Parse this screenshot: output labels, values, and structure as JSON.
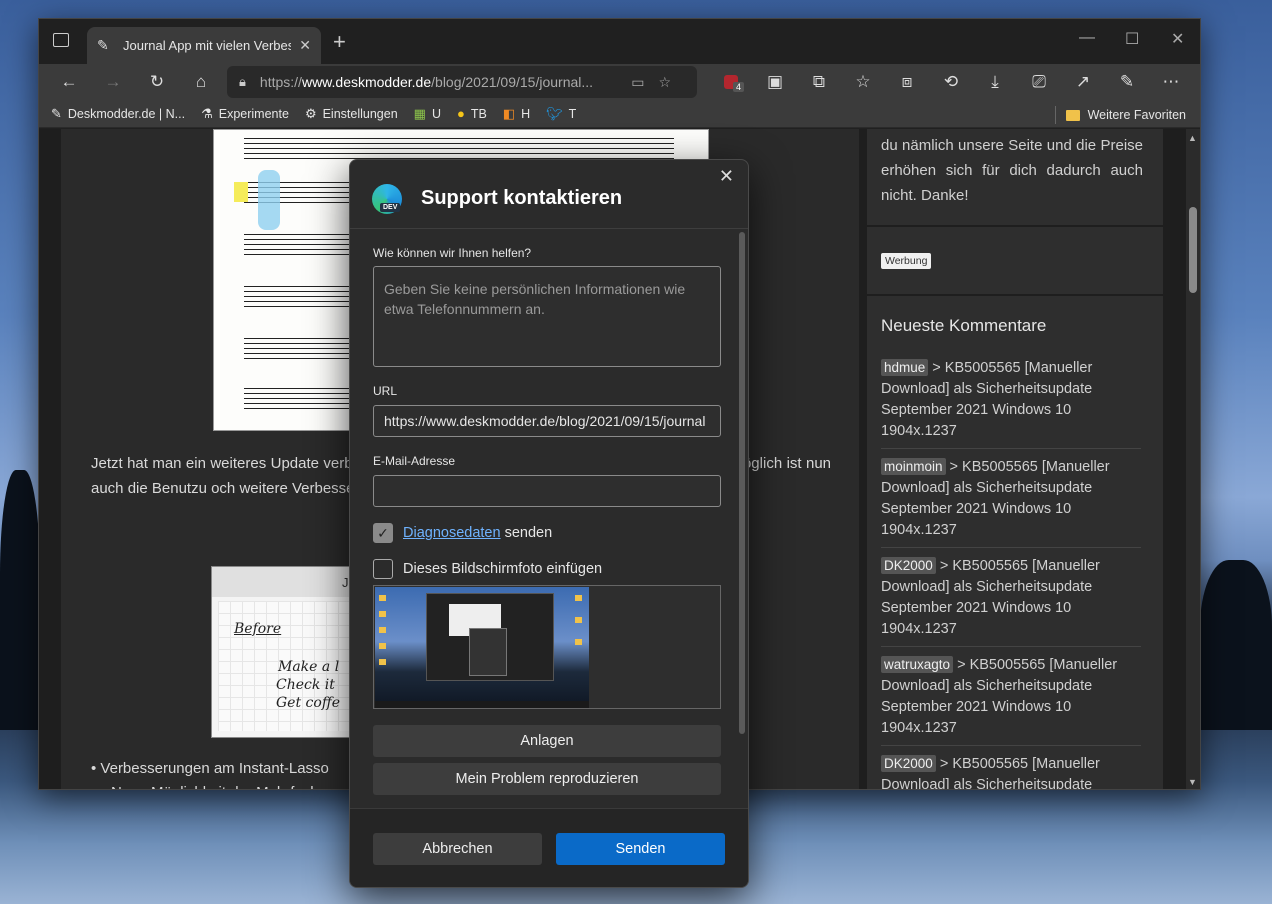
{
  "browser": {
    "tab_title": "Journal App mit vielen Verbesser",
    "url_prefix": "https://",
    "url_host": "www.deskmodder.de",
    "url_path": "/blog/2021/09/15/journal...",
    "extension_badge": "4"
  },
  "favorites": {
    "items": [
      {
        "label": "Deskmodder.de | N...",
        "icon": "pen-icon"
      },
      {
        "label": "Experimente",
        "icon": "flask-icon"
      },
      {
        "label": "Einstellungen",
        "icon": "gear-icon"
      },
      {
        "label": "U",
        "icon": "ext-icon"
      },
      {
        "label": "TB",
        "icon": "coin-icon"
      },
      {
        "label": "H",
        "icon": "stack-icon"
      },
      {
        "label": "T",
        "icon": "bird-icon"
      }
    ],
    "more_label": "Weitere Favoriten"
  },
  "article": {
    "paragraph": "Jetzt hat man ein weiteres Update                                                                                verbessert. Unterstützt werden für das Schreibe                                                                          ch Deutsch. Möglich ist nun auch die Benutzu                                                                            och weitere Verbesserungen vorgenommen.",
    "bullet_1": "Verbesserungen am Instant-Lasso",
    "bullet_2": "Neue Möglichkeit der Mehrfach",
    "handwriting": [
      "Before",
      "Make a l",
      "Check it",
      "Get coffe"
    ],
    "screenshot_title": "J"
  },
  "sidebar": {
    "intro": "du nämlich unsere Seite und die Preise erhöhen sich für dich dadurch auch nicht. Danke!",
    "ad_label": "Werbung",
    "heading": "Neueste Kommentare",
    "comments": [
      {
        "author": "hdmue",
        "text": " > KB5005565 [Manueller Download] als Sicherheitsupdate September 2021 Windows 10 1904x.1237"
      },
      {
        "author": "moinmoin",
        "text": " > KB5005565 [Manueller Download] als Sicherheitsupdate September 2021 Windows 10 1904x.1237"
      },
      {
        "author": "DK2000",
        "text": " > KB5005565 [Manueller Download] als Sicherheitsupdate September 2021 Windows 10 1904x.1237"
      },
      {
        "author": "watruxagto",
        "text": " > KB5005565 [Manueller Download] als Sicherheitsupdate September 2021 Windows 10 1904x.1237"
      },
      {
        "author": "DK2000",
        "text": " > KB5005565 [Manueller Download] als Sicherheitsupdate"
      }
    ]
  },
  "dialog": {
    "title": "Support kontaktieren",
    "logo_badge": "DEV",
    "help_label": "Wie können wir Ihnen helfen?",
    "help_placeholder": "Geben Sie keine persönlichen Informationen wie etwa Telefonnummern an.",
    "url_label": "URL",
    "url_value": "https://www.deskmodder.de/blog/2021/09/15/journal",
    "email_label": "E-Mail-Adresse",
    "email_value": "",
    "diag_link": "Diagnosedaten",
    "diag_rest": " senden",
    "diag_checked": true,
    "screenshot_label": "Dieses Bildschirmfoto einfügen",
    "screenshot_checked": false,
    "attachments_button": "Anlagen",
    "reproduce_button": "Mein Problem reproduzieren",
    "cancel_button": "Abbrechen",
    "send_button": "Senden"
  }
}
